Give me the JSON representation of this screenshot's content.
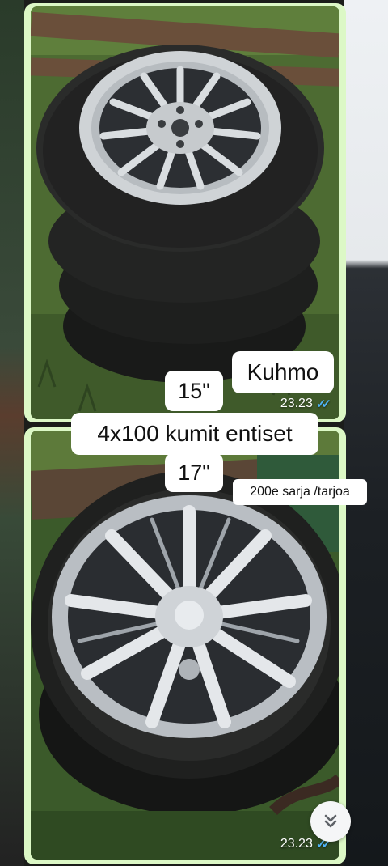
{
  "messages": [
    {
      "time": "23.23",
      "status": "read"
    },
    {
      "time": "23.23",
      "status": "read"
    }
  ],
  "overlay_labels": {
    "brand": "Kuhmo",
    "size_small": "15\"",
    "bolt_pattern": "4x100 kumit entiset",
    "size_large": "17\"",
    "price": "200e sarja /tarjoa"
  },
  "icons": {
    "scroll": "chevron-double-down-icon",
    "read_receipt": "double-check-icon"
  },
  "colors": {
    "bubble": "#dcf8c6",
    "read_ticks": "#4fb3f6"
  }
}
